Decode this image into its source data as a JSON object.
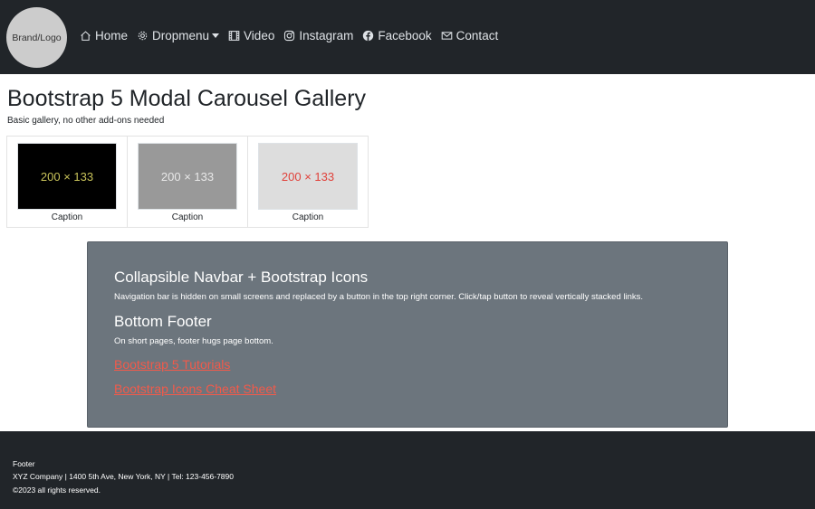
{
  "navbar": {
    "brand": "Brand/Logo",
    "items": [
      {
        "label": "Home",
        "icon": "house-icon"
      },
      {
        "label": "Dropmenu",
        "icon": "gear-icon",
        "dropdown": true
      },
      {
        "label": "Video",
        "icon": "film-icon"
      },
      {
        "label": "Instagram",
        "icon": "instagram-icon"
      },
      {
        "label": "Facebook",
        "icon": "facebook-icon"
      },
      {
        "label": "Contact",
        "icon": "envelope-icon"
      }
    ]
  },
  "main": {
    "title": "Bootstrap 5 Modal Carousel Gallery",
    "subtitle": "Basic gallery, no other add-ons needed"
  },
  "gallery": [
    {
      "placeholder": "200 × 133",
      "caption": "Caption",
      "bg": "#000000",
      "fg": "#c9c35a"
    },
    {
      "placeholder": "200 × 133",
      "caption": "Caption",
      "bg": "#999999",
      "fg": "#e8e8e8"
    },
    {
      "placeholder": "200 × 133",
      "caption": "Caption",
      "bg": "#dddddd",
      "fg": "#e0413a"
    }
  ],
  "panel": {
    "heading1": "Collapsible Navbar + Bootstrap Icons",
    "text1": "Navigation bar is hidden on small screens and replaced by a button in the top right corner. Click/tap button to reveal vertically stacked links.",
    "heading2": "Bottom Footer",
    "text2": "On short pages, footer hugs page bottom.",
    "link1": "Bootstrap 5 Tutorials",
    "link2": "Bootstrap Icons Cheat Sheet"
  },
  "footer": {
    "line1": "Footer",
    "line2": "XYZ Company | 1400 5th Ave, New York, NY | Tel: 123-456-7890",
    "line3": "©2023 all rights reserved."
  },
  "colors": {
    "navbar_bg": "#212529",
    "panel_bg": "#6c757d",
    "link": "#f25a4a"
  }
}
